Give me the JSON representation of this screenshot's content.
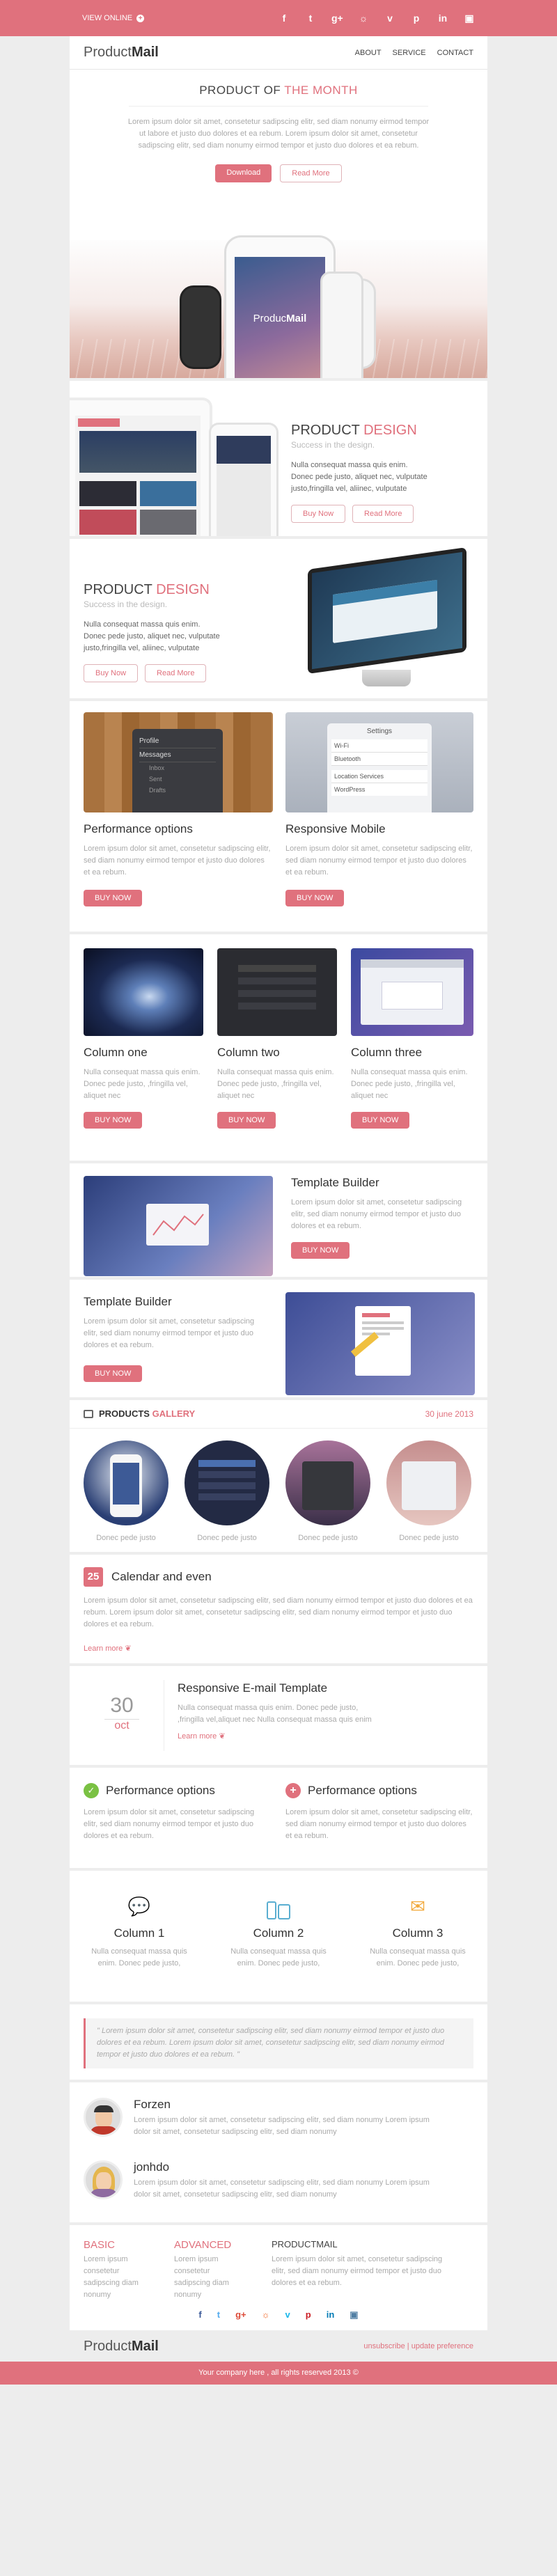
{
  "topbar": {
    "view_online": "VIEW ONLINE",
    "social_icons": [
      "facebook-icon",
      "twitter-icon",
      "google-plus-icon",
      "rss-icon",
      "vimeo-icon",
      "pinterest-icon",
      "linkedin-icon",
      "instagram-icon"
    ]
  },
  "header": {
    "logo_a": "Product",
    "logo_b": "Mail",
    "nav": [
      "ABOUT",
      "SERVICE",
      "CONTACT"
    ]
  },
  "hero": {
    "title_a": "PRODUCT OF",
    "title_b": "THE MONTH",
    "text": "Lorem ipsum dolor sit amet, consetetur sadipscing elitr, sed diam nonumy eirmod tempor ut labore et justo duo dolores et ea rebum. Lorem ipsum dolor sit amet, consetetur sadipscing elitr, sed diam nonumy eirmod tempor et justo duo dolores et ea rebum.",
    "download": "Download",
    "read_more": "Read More",
    "phone_brand_a": "Produc",
    "phone_brand_b": "Mail"
  },
  "design1": {
    "title_a": "PRODUCT",
    "title_b": "DESIGN",
    "subtitle": "Success in the design.",
    "text": "Nulla consequat massa quis enim. Donec pede justo, aliquet nec, vulputate justo,fringilla vel, aliinec, vulputate",
    "buy": "Buy Now",
    "read": "Read More"
  },
  "design2": {
    "title_a": "PRODUCT",
    "title_b": "DESIGN",
    "subtitle": "Success in the design.",
    "text": "Nulla consequat massa quis enim. Donec pede justo, aliquet nec, vulputate justo,fringilla vel, aliinec, vulputate",
    "buy": "Buy Now",
    "read": "Read More"
  },
  "two_col": [
    {
      "title": "Performance options",
      "text": "Lorem ipsum dolor sit amet, consetetur sadipscing elitr, sed diam nonumy eirmod tempor et justo duo dolores et ea rebum.",
      "btn": "BUY NOW",
      "menu": [
        "Profile",
        "Messages",
        "Inbox",
        "Sent",
        "Drafts"
      ]
    },
    {
      "title": "Responsive Mobile",
      "text": "Lorem ipsum dolor sit amet, consetetur sadipscing elitr, sed diam nonumy eirmod tempor et justo duo dolores et ea rebum.",
      "btn": "BUY NOW",
      "settings_title": "Settings",
      "settings": [
        "Wi-Fi",
        "Bluetooth",
        "Location Services",
        "WordPress"
      ]
    }
  ],
  "three_col": [
    {
      "title": "Column one",
      "text": "Nulla consequat massa quis enim. Donec pede justo, ,fringilla vel, aliquet nec",
      "btn": "BUY NOW"
    },
    {
      "title": "Column two",
      "text": "Nulla consequat massa quis enim. Donec pede justo, ,fringilla vel, aliquet nec",
      "btn": "BUY NOW"
    },
    {
      "title": "Column three",
      "text": "Nulla consequat massa quis enim. Donec pede justo, ,fringilla vel, aliquet nec",
      "btn": "BUY NOW"
    }
  ],
  "builder1": {
    "title": "Template Builder",
    "text": "Lorem ipsum dolor sit amet, consetetur sadipscing elitr, sed diam nonumy eirmod tempor et justo duo dolores et ea rebum.",
    "btn": "BUY NOW"
  },
  "builder2": {
    "title": "Template Builder",
    "text": "Lorem ipsum dolor sit amet, consetetur sadipscing elitr, sed diam nonumy eirmod tempor et justo duo dolores et ea rebum.",
    "btn": "BUY NOW"
  },
  "gallery": {
    "title_a": "PRODUCTS",
    "title_b": "GALLERY",
    "date": "30 june 2013",
    "captions": [
      "Donec pede justo",
      "Donec pede justo",
      "Donec pede justo",
      "Donec pede justo"
    ]
  },
  "calendar": {
    "day": "25",
    "title": "Calendar and even",
    "text": "Lorem ipsum dolor sit amet, consetetur sadipscing elitr, sed diam nonumy eirmod tempor et justo duo dolores et ea rebum. Lorem ipsum dolor sit amet, consetetur sadipscing elitr, sed diam nonumy eirmod tempor et justo duo dolores et ea rebum.",
    "learn": "Learn more"
  },
  "event": {
    "day": "30",
    "month": "oct",
    "title": "Responsive E-mail Template",
    "text": "Nulla consequat massa quis enim. Donec pede justo, ,fringilla vel,aliquet nec Nulla consequat massa quis enim",
    "learn": "Learn more"
  },
  "perf": [
    {
      "title": "Performance options",
      "text": "Lorem ipsum dolor sit amet, consetetur sadipscing elitr, sed diam nonumy eirmod tempor et justo duo dolores et ea rebum."
    },
    {
      "title": "Performance options",
      "text": "Lorem ipsum dolor sit amet, consetetur sadipscing elitr, sed diam nonumy eirmod tempor et justo duo dolores et ea rebum."
    }
  ],
  "icon_cols": [
    {
      "title": "Column 1",
      "text": "Nulla consequat massa quis enim. Donec pede justo,"
    },
    {
      "title": "Column 2",
      "text": "Nulla consequat massa quis enim. Donec pede justo,"
    },
    {
      "title": "Column 3",
      "text": "Nulla consequat massa quis enim. Donec pede justo,"
    }
  ],
  "quote": {
    "text": "\" Lorem ipsum dolor sit amet, consetetur sadipscing elitr, sed diam nonumy eirmod tempor et justo duo dolores et ea rebum. Lorem ipsum dolor sit amet, consetetur sadipscing elitr, sed diam nonumy eirmod tempor et justo duo dolores et ea rebum. \""
  },
  "testimonials": [
    {
      "name": "Forzen",
      "text": "Lorem ipsum dolor sit amet, consetetur sadipscing elitr, sed diam nonumy Lorem ipsum dolor sit amet, consetetur sadipscing elitr, sed diam nonumy"
    },
    {
      "name": "jonhdo",
      "text": "Lorem ipsum dolor sit amet, consetetur sadipscing elitr, sed diam nonumy Lorem ipsum dolor sit amet, consetetur sadipscing elitr, sed diam nonumy"
    }
  ],
  "footer_cols": {
    "basic_title": "BASIC",
    "basic_text": "Lorem ipsum consetetur sadipscing diam nonumy",
    "adv_title": "ADVANCED",
    "adv_text": "Lorem ipsum consetetur sadipscing diam nonumy",
    "pm_title": "PRODUCTMAIL",
    "pm_text": "Lorem ipsum dolor sit amet, consetetur sadipscing elitr, sed diam nonumy eirmod tempor et justo duo dolores et ea rebum."
  },
  "footer": {
    "logo_a": "Product",
    "logo_b": "Mail",
    "unsubscribe": "unsubscribe",
    "update": "update preference",
    "copyright": "Your company here , all rights reserved 2013 ©"
  },
  "colors": {
    "accent": "#e0717d",
    "background": "#ededed"
  }
}
